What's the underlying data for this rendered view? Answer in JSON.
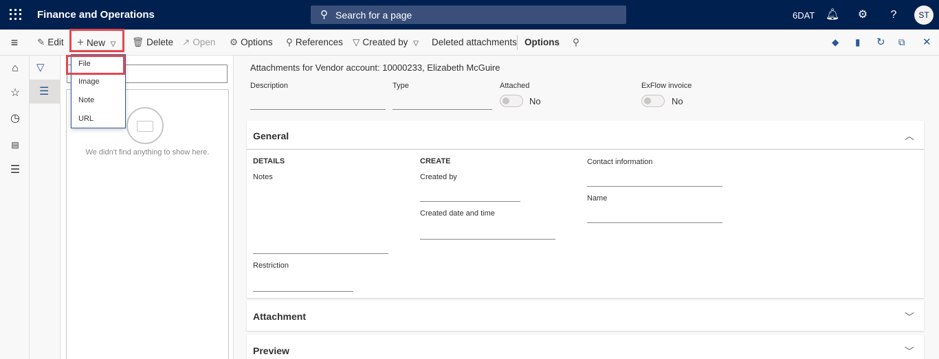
{
  "header": {
    "app_title": "Finance and Operations",
    "search_placeholder": "Search for a page",
    "company": "6DAT",
    "avatar_initials": "ST"
  },
  "actions": {
    "edit": "Edit",
    "new": "New",
    "delete": "Delete",
    "open": "Open",
    "options": "Options",
    "references": "References",
    "created_by": "Created by",
    "deleted_attachments": "Deleted attachments",
    "options_tab": "Options"
  },
  "new_menu": [
    "File",
    "Image",
    "Note",
    "URL"
  ],
  "list": {
    "empty_text": "We didn't find anything to show here."
  },
  "detail": {
    "heading": "Attachments for Vendor account: 10000233, Elizabeth McGuire",
    "header_fields": {
      "description": "Description",
      "type": "Type",
      "attached": "Attached",
      "attached_value": "No",
      "exflow": "ExFlow invoice",
      "exflow_value": "No"
    },
    "general": {
      "title": "General",
      "details_header": "DETAILS",
      "notes": "Notes",
      "restriction": "Restriction",
      "create_header": "CREATE",
      "created_by": "Created by",
      "created_datetime": "Created date and time",
      "contact_info": "Contact information",
      "name": "Name"
    },
    "attachment_title": "Attachment",
    "preview_title": "Preview"
  },
  "colors": {
    "nav_bar": "#002050",
    "highlight": "#e4474e",
    "accent": "#2b579a"
  }
}
